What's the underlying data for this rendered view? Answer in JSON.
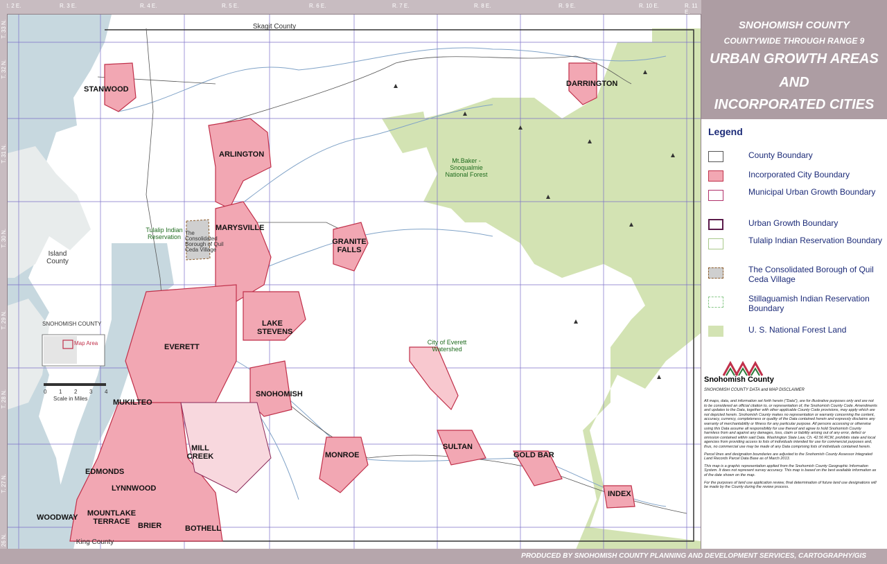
{
  "title": {
    "line1": "SNOHOMISH COUNTY",
    "line2": "COUNTYWIDE THROUGH RANGE 9",
    "line3": "URBAN GROWTH AREAS",
    "line4": "AND",
    "line5": "INCORPORATED CITIES"
  },
  "legend": {
    "title": "Legend",
    "items": [
      {
        "label": "County Boundary"
      },
      {
        "label": "Incorporated City Boundary"
      },
      {
        "label": "Municipal Urban Growth Boundary"
      },
      {
        "label": "Urban Growth Boundary"
      },
      {
        "label": "Tulalip Indian Reservation Boundary"
      },
      {
        "label": "The Consolidated Borough of Quil Ceda Village"
      },
      {
        "label": "Stillaguamish Indian Reservation Boundary"
      },
      {
        "label": "U. S. National Forest Land"
      }
    ]
  },
  "logo": {
    "label": "Snohomish County"
  },
  "disclaimer": {
    "title": "SNOHOMISH COUNTY DATA and MAP DISCLAIMER",
    "body": "All maps, data, and information set forth herein (\"Data\"), are for illustrative purposes only and are not to be considered an official citation to, or representation of, the Snohomish County Code. Amendments and updates to the Data, together with other applicable County Code provisions, may apply which are not depicted herein. Snohomish County makes no representation or warranty concerning the content, accuracy, currency, completeness or quality of the Data contained herein and expressly disclaims any warranty of merchantability or fitness for any particular purpose. All persons accessing or otherwise using this Data assume all responsibility for use thereof and agree to hold Snohomish County harmless from and against any damages, loss, claim or liability arising out of any error, defect or omission contained within said Data. Washington State Law, Ch. 42.56 RCW, prohibits state and local agencies from providing access to lists of individuals intended for use for commercial purposes and, thus, no commercial use may be made of any Data comprising lists of individuals contained herein.",
    "parcel": "Parcel lines and designation boundaries are adjusted to the Snohomish County Assessor Integrated Land Records Parcel Data Base as of March 2013.",
    "graphic": "This map is a graphic representation applied from the Snohomish County Geographic Information System. It does not represent survey accuracy. This map is based on the best available information as of the date shown on the map.",
    "purposes": "For the purposes of land use application review, final determination of future land use designations will be made by the County during the review process."
  },
  "footer": "PRODUCED BY SNOHOMISH COUNTY PLANNING AND DEVELOPMENT SERVICES, CARTOGRAPHY/GIS",
  "ranges": [
    "R. 2 E.",
    "R. 3 E.",
    "R. 4 E.",
    "R. 5 E.",
    "R. 6 E.",
    "R. 7 E.",
    "R. 8 E.",
    "R. 9 E.",
    "R. 10 E.",
    "R. 11 E."
  ],
  "townships": [
    "T. 33 N.",
    "T. 32 N.",
    "T. 31 N.",
    "T. 30 N.",
    "T. 29 N.",
    "T. 28 N.",
    "T. 27 N.",
    "T. 26 N."
  ],
  "cities": {
    "stanwood": "STANWOOD",
    "arlington": "ARLINGTON",
    "marysville": "MARYSVILLE",
    "granite_falls": "GRANITE FALLS",
    "darrington": "DARRINGTON",
    "lake_stevens": "LAKE STEVENS",
    "everett": "EVERETT",
    "snohomish": "SNOHOMISH",
    "mukilteo": "MUKILTEO",
    "mill_creek": "MILL CREEK",
    "monroe": "MONROE",
    "sultan": "SULTAN",
    "gold_bar": "GOLD BAR",
    "index": "INDEX",
    "edmonds": "EDMONDS",
    "lynnwood": "LYNNWOOD",
    "woodway": "WOODWAY",
    "mountlake_terrace": "MOUNTLAKE TERRACE",
    "brier": "BRIER",
    "bothell": "BOTHELL"
  },
  "labels": {
    "skagit": "Skagit County",
    "island": "Island County",
    "king": "King County",
    "tulalip": "Tulalip Indian Reservation",
    "quil_ceda": "The Consolidated Borough of Quil Ceda Village",
    "forest": "Mt.Baker - Snoqualmie National Forest",
    "watershed": "City of Everett Watershed",
    "inset_title": "SNOHOMISH COUNTY",
    "inset_area": "Map Area",
    "scale": "Scale in Miles",
    "scale_ticks": [
      "0",
      "1",
      "2",
      "3",
      "4"
    ]
  },
  "colors": {
    "city_fill": "#f2a7b3",
    "city_stroke": "#c0304a",
    "forest": "#d3e3b3",
    "water": "#c7d8df",
    "grid": "#7b6fc8",
    "title_bg": "#ad9da3",
    "legend_text": "#1c2b78"
  }
}
